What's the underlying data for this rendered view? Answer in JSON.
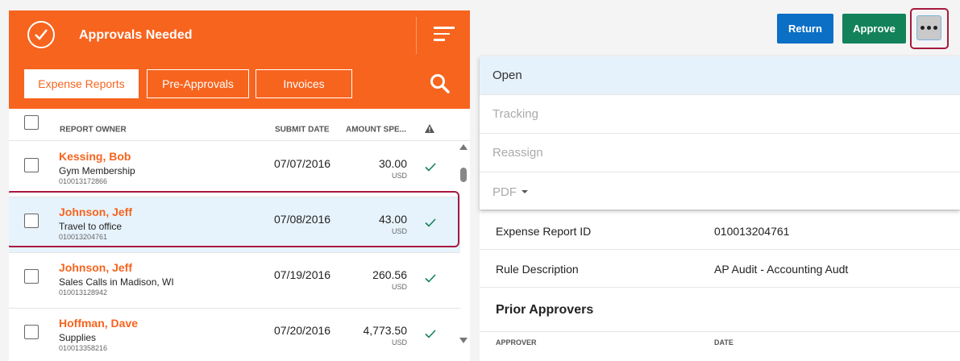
{
  "header": {
    "title": "Approvals Needed",
    "tabs": [
      {
        "label": "Expense Reports",
        "active": true
      },
      {
        "label": "Pre-Approvals",
        "active": false
      },
      {
        "label": "Invoices",
        "active": false
      }
    ],
    "accent_color": "#f7641e"
  },
  "columns": {
    "owner": "REPORT OWNER",
    "date": "SUBMIT DATE",
    "amount": "AMOUNT SPE..."
  },
  "reports": [
    {
      "owner": "Kessing, Bob",
      "purpose": "Gym Membership",
      "id": "010013172866",
      "date": "07/07/2016",
      "amount": "30.00",
      "currency": "USD"
    },
    {
      "owner": "Johnson, Jeff",
      "purpose": "Travel to office",
      "id": "010013204761",
      "date": "07/08/2016",
      "amount": "43.00",
      "currency": "USD"
    },
    {
      "owner": "Johnson, Jeff",
      "purpose": "Sales Calls in Madison, WI",
      "id": "010013128942",
      "date": "07/19/2016",
      "amount": "260.56",
      "currency": "USD"
    },
    {
      "owner": "Hoffman, Dave",
      "purpose": "Supplies",
      "id": "010013358216",
      "date": "07/20/2016",
      "amount": "4,773.50",
      "currency": "USD"
    }
  ],
  "toolbar": {
    "return_label": "Return",
    "approve_label": "Approve"
  },
  "menu": {
    "items": [
      "Open",
      "Tracking",
      "Reassign",
      "PDF"
    ]
  },
  "details": {
    "rows": [
      {
        "key": "Expense Report ID",
        "value": "010013204761"
      },
      {
        "key": "Rule Description",
        "value": "AP Audit - Accounting Audt"
      }
    ],
    "prior_title": "Prior Approvers",
    "prior_col_approver": "APPROVER",
    "prior_col_date": "DATE"
  }
}
